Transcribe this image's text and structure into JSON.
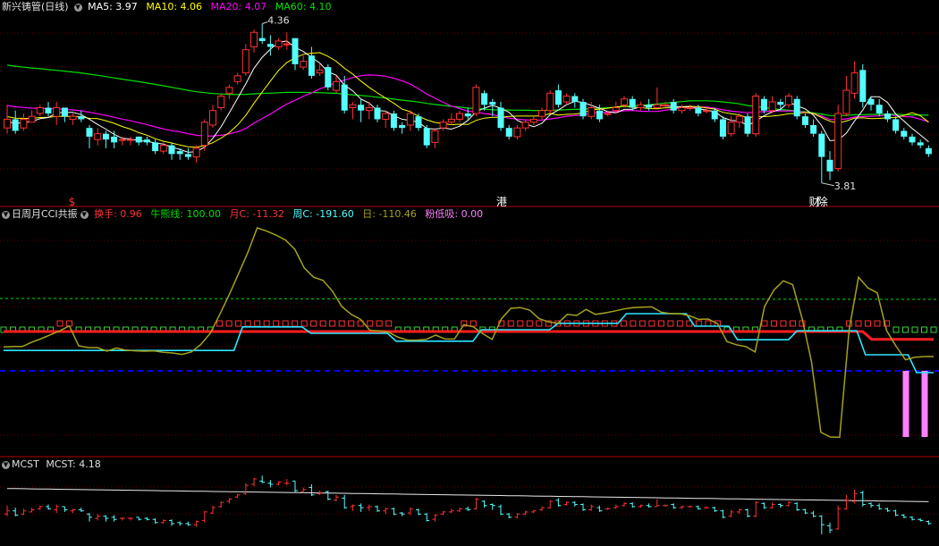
{
  "panel1": {
    "title": "新兴铸管(日线)",
    "ma5_label": "MA5: 3.97",
    "ma10_label": "MA10: 4.06",
    "ma20_label": "MA20: 4.07",
    "ma60_label": "MA60: 4.10",
    "high_label": "4.36",
    "low_label": "3.81",
    "markers": [
      "$",
      "港",
      "财",
      "除"
    ]
  },
  "panel2": {
    "title": "日周月CCI共振",
    "huanshou": "换手: 0.96",
    "niuxiong": "牛熊线: 100.00",
    "yue_c": "月C: -11.32",
    "zhou_c": "周C: -191.60",
    "ri": "日: -110.46",
    "fen": "粉低吸: 0.00"
  },
  "panel3": {
    "title": "MCST",
    "value_label": "MCST: 4.18"
  },
  "colors": {
    "background": "#000000",
    "up": "#ff3232",
    "down": "#54ffff",
    "ma5": "#ffffff",
    "ma10": "#ffff00",
    "ma20": "#ff00ff",
    "ma60": "#00e000",
    "cci_day": "#a4a21c",
    "cci_week": "#2ce6ff",
    "cci_month": "#ff1e1e",
    "pink": "#ff80ff",
    "grid": "#6a0000",
    "separator": "#b00000"
  },
  "chart_data": [
    {
      "type": "candlestick",
      "title": "新兴铸管(日线)",
      "ylim": [
        3.8,
        4.38
      ],
      "high": 4.36,
      "low": 3.81,
      "candles": [
        [
          4.0,
          4.03,
          4.08,
          3.98
        ],
        [
          4.03,
          3.99,
          4.06,
          3.98
        ],
        [
          4.0,
          4.03,
          4.05,
          3.99
        ],
        [
          4.02,
          4.04,
          4.06,
          4.02
        ],
        [
          4.05,
          4.07,
          4.08,
          4.04
        ],
        [
          4.07,
          4.05,
          4.09,
          4.04
        ],
        [
          4.04,
          4.07,
          4.09,
          4.01
        ],
        [
          4.07,
          4.04,
          4.07,
          4.02
        ],
        [
          4.03,
          4.04,
          4.05,
          4.01
        ],
        [
          4.04,
          4.03,
          4.06,
          4.02
        ],
        [
          4.0,
          3.97,
          4.01,
          3.93
        ],
        [
          3.96,
          3.98,
          4.0,
          3.94
        ],
        [
          3.98,
          3.96,
          3.99,
          3.93
        ],
        [
          3.97,
          3.95,
          3.99,
          3.93
        ],
        [
          3.96,
          3.96,
          3.97,
          3.94
        ],
        [
          3.96,
          3.96,
          3.97,
          3.94
        ],
        [
          3.97,
          3.95,
          3.97,
          3.94
        ],
        [
          3.96,
          3.95,
          3.97,
          3.94
        ],
        [
          3.95,
          3.92,
          3.96,
          3.91
        ],
        [
          3.92,
          3.94,
          3.95,
          3.91
        ],
        [
          3.94,
          3.91,
          3.95,
          3.89
        ],
        [
          3.92,
          3.91,
          3.93,
          3.89
        ],
        [
          3.91,
          3.9,
          3.93,
          3.89
        ],
        [
          3.9,
          3.93,
          3.94,
          3.88
        ],
        [
          3.94,
          4.02,
          4.03,
          3.92
        ],
        [
          4.01,
          4.06,
          4.08,
          4.0
        ],
        [
          4.07,
          4.11,
          4.12,
          4.06
        ],
        [
          4.12,
          4.14,
          4.15,
          4.1
        ],
        [
          4.16,
          4.18,
          4.19,
          4.15
        ],
        [
          4.19,
          4.27,
          4.29,
          4.18
        ],
        [
          4.28,
          4.33,
          4.34,
          4.26
        ],
        [
          4.31,
          4.3,
          4.36,
          4.29
        ],
        [
          4.29,
          4.28,
          4.32,
          4.25
        ],
        [
          4.28,
          4.3,
          4.31,
          4.27
        ],
        [
          4.29,
          4.29,
          4.33,
          4.27
        ],
        [
          4.31,
          4.22,
          4.31,
          4.2
        ],
        [
          4.21,
          4.23,
          4.25,
          4.2
        ],
        [
          4.25,
          4.18,
          4.28,
          4.17
        ],
        [
          4.19,
          4.2,
          4.22,
          4.18
        ],
        [
          4.21,
          4.14,
          4.22,
          4.13
        ],
        [
          4.13,
          4.16,
          4.18,
          4.12
        ],
        [
          4.15,
          4.06,
          4.18,
          4.05
        ],
        [
          4.07,
          4.08,
          4.09,
          4.03
        ],
        [
          4.08,
          4.06,
          4.1,
          4.02
        ],
        [
          4.06,
          4.07,
          4.09,
          4.03
        ],
        [
          4.07,
          4.03,
          4.08,
          4.02
        ],
        [
          4.03,
          4.05,
          4.06,
          4.0
        ],
        [
          4.05,
          4.0,
          4.06,
          3.99
        ],
        [
          4.01,
          4.0,
          4.02,
          3.98
        ],
        [
          4.01,
          4.05,
          4.06,
          3.99
        ],
        [
          4.04,
          4.0,
          4.05,
          3.99
        ],
        [
          4.0,
          3.94,
          4.01,
          3.93
        ],
        [
          3.95,
          3.99,
          4.0,
          3.93
        ],
        [
          4.0,
          4.02,
          4.03,
          3.99
        ],
        [
          4.02,
          4.03,
          4.05,
          4.01
        ],
        [
          4.03,
          4.05,
          4.06,
          4.02
        ],
        [
          4.05,
          4.04,
          4.07,
          4.03
        ],
        [
          4.05,
          4.14,
          4.15,
          4.04
        ],
        [
          4.12,
          4.08,
          4.13,
          4.06
        ],
        [
          4.09,
          4.08,
          4.1,
          4.04
        ],
        [
          4.07,
          4.0,
          4.09,
          3.99
        ],
        [
          4.0,
          3.97,
          4.01,
          3.96
        ],
        [
          3.97,
          4.0,
          4.01,
          3.96
        ],
        [
          4.0,
          4.02,
          4.03,
          3.99
        ],
        [
          4.02,
          4.03,
          4.04,
          4.01
        ],
        [
          4.04,
          4.06,
          4.07,
          4.03
        ],
        [
          4.06,
          4.12,
          4.13,
          4.05
        ],
        [
          4.13,
          4.08,
          4.15,
          4.07
        ],
        [
          4.09,
          4.11,
          4.12,
          4.08
        ],
        [
          4.11,
          4.09,
          4.12,
          4.07
        ],
        [
          4.09,
          4.04,
          4.1,
          4.03
        ],
        [
          4.04,
          4.07,
          4.09,
          4.03
        ],
        [
          4.06,
          4.03,
          4.08,
          4.02
        ],
        [
          4.05,
          4.05,
          4.06,
          4.04
        ],
        [
          4.06,
          4.07,
          4.09,
          4.05
        ],
        [
          4.08,
          4.1,
          4.11,
          4.07
        ],
        [
          4.1,
          4.07,
          4.11,
          4.06
        ],
        [
          4.07,
          4.08,
          4.09,
          4.06
        ],
        [
          4.08,
          4.07,
          4.1,
          4.06
        ],
        [
          4.07,
          4.08,
          4.14,
          4.07
        ],
        [
          4.08,
          4.08,
          4.09,
          4.07
        ],
        [
          4.09,
          4.06,
          4.1,
          4.05
        ],
        [
          4.06,
          4.07,
          4.08,
          4.05
        ],
        [
          4.07,
          4.07,
          4.08,
          4.06
        ],
        [
          4.07,
          4.05,
          4.08,
          4.04
        ],
        [
          4.06,
          4.06,
          4.07,
          4.05
        ],
        [
          4.06,
          4.03,
          4.07,
          4.02
        ],
        [
          4.03,
          3.97,
          4.04,
          3.96
        ],
        [
          3.98,
          4.02,
          4.04,
          3.97
        ],
        [
          4.02,
          4.04,
          4.05,
          4.0
        ],
        [
          4.04,
          3.98,
          4.05,
          3.97
        ],
        [
          3.98,
          4.11,
          4.12,
          3.97
        ],
        [
          4.1,
          4.06,
          4.11,
          4.05
        ],
        [
          4.06,
          4.09,
          4.11,
          4.05
        ],
        [
          4.09,
          4.08,
          4.1,
          4.06
        ],
        [
          4.08,
          4.11,
          4.12,
          4.07
        ],
        [
          4.1,
          4.04,
          4.11,
          4.03
        ],
        [
          4.04,
          4.01,
          4.05,
          4.0
        ],
        [
          4.01,
          3.98,
          4.03,
          3.97
        ],
        [
          3.98,
          3.9,
          3.99,
          3.81
        ],
        [
          3.89,
          3.85,
          3.92,
          3.82
        ],
        [
          3.86,
          4.05,
          4.08,
          3.85
        ],
        [
          4.05,
          4.13,
          4.18,
          4.04
        ],
        [
          4.12,
          4.19,
          4.23,
          4.1
        ],
        [
          4.2,
          4.09,
          4.22,
          4.07
        ],
        [
          4.1,
          4.08,
          4.11,
          4.06
        ],
        [
          4.08,
          4.05,
          4.1,
          4.04
        ],
        [
          4.05,
          4.03,
          4.06,
          4.02
        ],
        [
          4.03,
          3.99,
          4.04,
          3.98
        ],
        [
          3.99,
          3.97,
          4.0,
          3.96
        ],
        [
          3.97,
          3.95,
          3.98,
          3.94
        ],
        [
          3.95,
          3.94,
          3.96,
          3.93
        ],
        [
          3.93,
          3.91,
          3.94,
          3.9
        ]
      ]
    },
    {
      "type": "line",
      "title": "日周月CCI共振",
      "ylim": [
        -300,
        300
      ],
      "series": [
        {
          "name": "日",
          "values": [
            -33,
            -32,
            -32,
            -20,
            -10,
            1,
            12,
            26,
            -30,
            -35,
            -35,
            -45,
            -36,
            -42,
            -44,
            -45,
            -44,
            -48,
            -50,
            -54,
            -47,
            -26,
            5,
            57,
            112,
            171,
            231,
            300,
            291,
            280,
            266,
            240,
            188,
            162,
            153,
            123,
            80,
            58,
            44,
            13,
            12,
            8,
            -6,
            -14,
            -14,
            -12,
            0,
            -11,
            -11,
            29,
            23,
            4,
            -12,
            46,
            75,
            77,
            70,
            46,
            37,
            33,
            58,
            55,
            72,
            58,
            62,
            67,
            73,
            77,
            78,
            79,
            64,
            60,
            60,
            54,
            44,
            45,
            32,
            -18,
            -27,
            -32,
            -47,
            80,
            126,
            152,
            141,
            47,
            -74,
            -272,
            -285,
            -286,
            15,
            162,
            132,
            118,
            12,
            -31,
            -69,
            -62,
            -60,
            -60
          ]
        },
        {
          "name": "周",
          "values": [
            -43,
            -43,
            -43,
            -43,
            -43,
            -43,
            -43,
            -43,
            -43,
            -43,
            -43,
            -43,
            -43,
            -43,
            -43,
            -43,
            -43,
            -43,
            -43,
            -43,
            -43,
            -43,
            -43,
            -43,
            -43,
            -43,
            -43,
            -43,
            23,
            23,
            23,
            23,
            23,
            23,
            23,
            23,
            5,
            5,
            5,
            5,
            5,
            5,
            5,
            5,
            5,
            5,
            -17,
            -17,
            -17,
            -17,
            -17,
            -17,
            -17,
            -17,
            -17,
            -17,
            15,
            15,
            15,
            15,
            15,
            15,
            15,
            15,
            15,
            33,
            33,
            33,
            33,
            33,
            33,
            33,
            33,
            60,
            60,
            60,
            60,
            60,
            60,
            60,
            60,
            25,
            25,
            25,
            25,
            25,
            -13,
            -13,
            -13,
            -13,
            -13,
            -13,
            -13,
            12,
            12,
            12,
            12,
            12,
            12,
            12,
            12,
            -55,
            -55,
            -55,
            -55,
            -55,
            -55,
            -105,
            -105,
            -105
          ]
        },
        {
          "name": "月",
          "values": [
            10,
            10,
            10,
            10,
            10,
            10,
            10,
            10,
            10,
            10,
            10,
            10,
            10,
            10,
            10,
            10,
            10,
            10,
            10,
            10,
            10,
            10,
            10,
            10,
            10,
            10,
            10,
            10,
            10,
            10,
            10,
            10,
            10,
            10,
            10,
            10,
            10,
            10,
            10,
            10,
            10,
            10,
            10,
            10,
            10,
            10,
            10,
            10,
            10,
            10,
            10,
            10,
            10,
            10,
            10,
            10,
            10,
            10,
            10,
            10,
            10,
            10,
            10,
            10,
            10,
            10,
            10,
            10,
            10,
            10,
            10,
            10,
            10,
            10,
            10,
            10,
            10,
            10,
            10,
            10,
            10,
            10,
            10,
            10,
            10,
            10,
            10,
            10,
            10,
            10,
            10,
            10,
            10,
            10,
            10,
            10,
            10,
            10,
            -12,
            -12,
            -12,
            -12,
            -12,
            -12,
            -12,
            -12
          ]
        }
      ]
    },
    {
      "type": "line",
      "title": "MCST",
      "series": [
        {
          "name": "MCST",
          "values": [
            4.18
          ]
        }
      ]
    }
  ]
}
